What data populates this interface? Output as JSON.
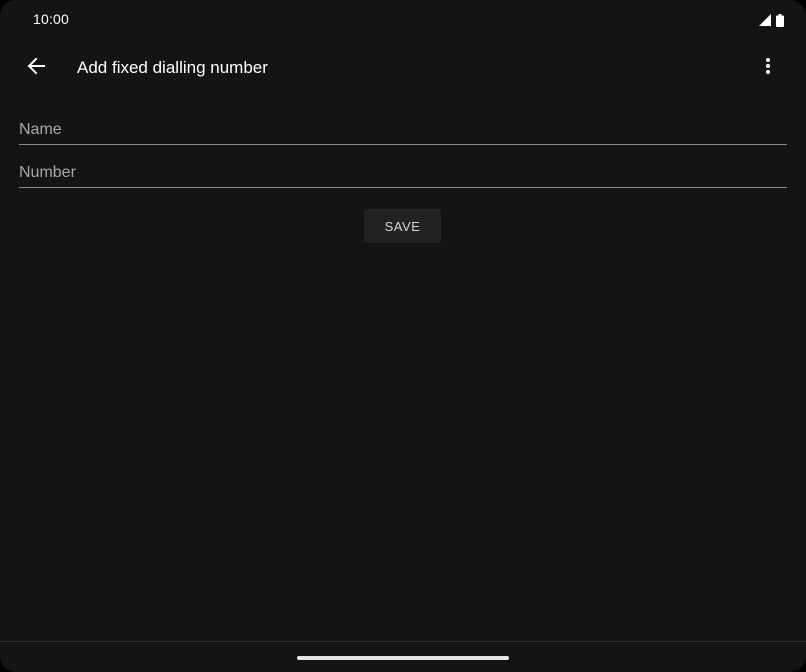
{
  "status_bar": {
    "time": "10:00",
    "icons": [
      "signal-icon",
      "battery-icon"
    ]
  },
  "app_bar": {
    "title": "Add fixed dialling number",
    "back_icon": "arrow-back-icon",
    "overflow_icon": "more-vert-icon"
  },
  "form": {
    "name_field": {
      "placeholder": "Name",
      "value": ""
    },
    "number_field": {
      "placeholder": "Number",
      "value": ""
    },
    "save_label": "SAVE"
  },
  "colors": {
    "background": "#141414",
    "text": "#ffffff",
    "hint": "#a9a9a9",
    "underline": "#8a8a8a",
    "button_bg": "#222222"
  }
}
